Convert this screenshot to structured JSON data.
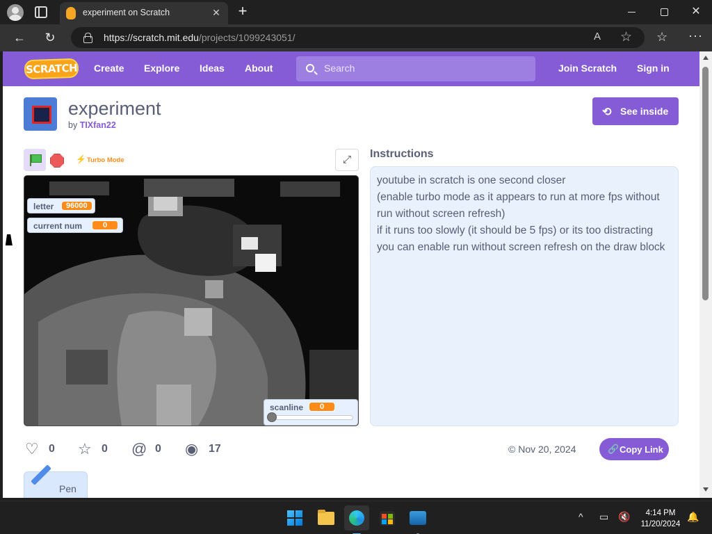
{
  "browser": {
    "tab_title": "experiment on Scratch",
    "new_tab_label": "+",
    "url_host": "https://scratch.mit.edu",
    "url_path": "/projects/1099243051/",
    "read_aloud_label": "A",
    "favorite_star": "☆",
    "favorites_label": "☆",
    "more_label": "···",
    "close_tab_label": "✕",
    "back_label": "←",
    "refresh_label": "↻",
    "window_close_label": "✕"
  },
  "nav": {
    "logo": "SCRATCH",
    "links": [
      "Create",
      "Explore",
      "Ideas",
      "About"
    ],
    "search_placeholder": "Search",
    "join": "Join Scratch",
    "signin": "Sign in"
  },
  "project": {
    "title": "experiment",
    "by_prefix": "by",
    "author": "TIXfan22",
    "see_inside": "See inside",
    "see_inside_icon": "⟲"
  },
  "player": {
    "turbo_icon": "⚡",
    "turbo_label": "Turbo Mode",
    "fullscreen_icon": "⤢",
    "monitors": {
      "letter": {
        "label": "letter",
        "value": "96000"
      },
      "current_num": {
        "label": "current num",
        "value": "0"
      },
      "scanline": {
        "label": "scanline",
        "value": "0",
        "slider_fraction": 0
      }
    }
  },
  "instructions": {
    "heading": "Instructions",
    "lines": [
      "youtube in scratch is one second closer",
      "(enable turbo mode as it appears to run at more fps without run without screen refresh)",
      "if it runs too slowly (it should be 5 fps) or its too distracting you can enable run without screen refresh on the draw block"
    ]
  },
  "stats": {
    "loves": "0",
    "favorites": "0",
    "remixes": "0",
    "views": "17",
    "icons": {
      "love": "♡",
      "favorite": "☆",
      "remix": "@",
      "views": "◉"
    }
  },
  "share": {
    "date_icon": "©",
    "date": "Nov 20, 2024",
    "copy_link": "Copy Link",
    "copy_link_icon": "🔗"
  },
  "extensions": {
    "pen": "Pen"
  },
  "taskbar": {
    "time": "4:14 PM",
    "date": "11/20/2024",
    "chevron": "^",
    "display_icon": "▭",
    "volume_icon": "🔇",
    "bell_icon": "🔔"
  },
  "colors": {
    "scratch_purple": "#855cd6",
    "monitor_orange": "#ff8c1a",
    "instructions_bg": "#e9f1fc"
  }
}
